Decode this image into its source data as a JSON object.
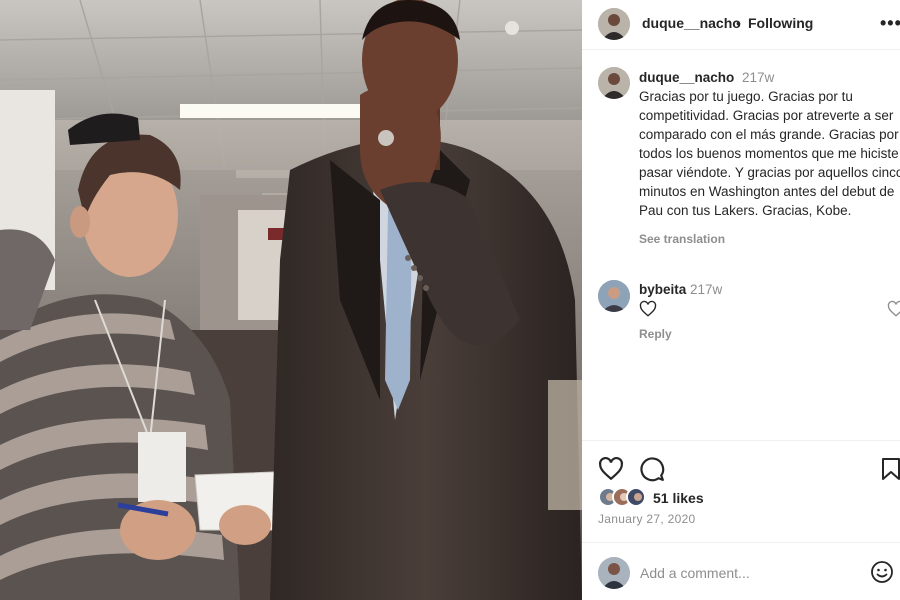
{
  "post": {
    "photo_icon": "photo",
    "header": {
      "username": "duque__nacho",
      "separator": "•",
      "follow_label": "Following",
      "more_icon": "more-horizontal-icon",
      "more_glyph": "•••"
    },
    "caption": {
      "username": "duque__nacho",
      "time": "217w",
      "text": "Gracias por tu juego. Gracias por tu competitividad. Gracias por atreverte a ser comparado con el más grande. Gracias por todos los buenos momentos que me hiciste pasar viéndote. Y gracias por aquellos cinco minutos en Washington antes del debut de Pau con tus Lakers. Gracias, Kobe.",
      "see_translation": "See translation"
    },
    "comments": [
      {
        "username": "bybeita",
        "time": "217w",
        "reply_label": "Reply",
        "heart_icon": "heart-outline-icon"
      }
    ],
    "actions": {
      "like_icon": "heart-outline-icon",
      "comment_icon": "comment-icon",
      "save_icon": "bookmark-icon"
    },
    "likes": "51 likes",
    "date": "January 27, 2020",
    "add_comment": {
      "placeholder": "Add a comment...",
      "emoji_icon": "smiley-icon"
    }
  },
  "colors": {
    "text": "#262626",
    "muted": "#8e8e8e",
    "border": "#efefef",
    "background": "#ffffff"
  }
}
